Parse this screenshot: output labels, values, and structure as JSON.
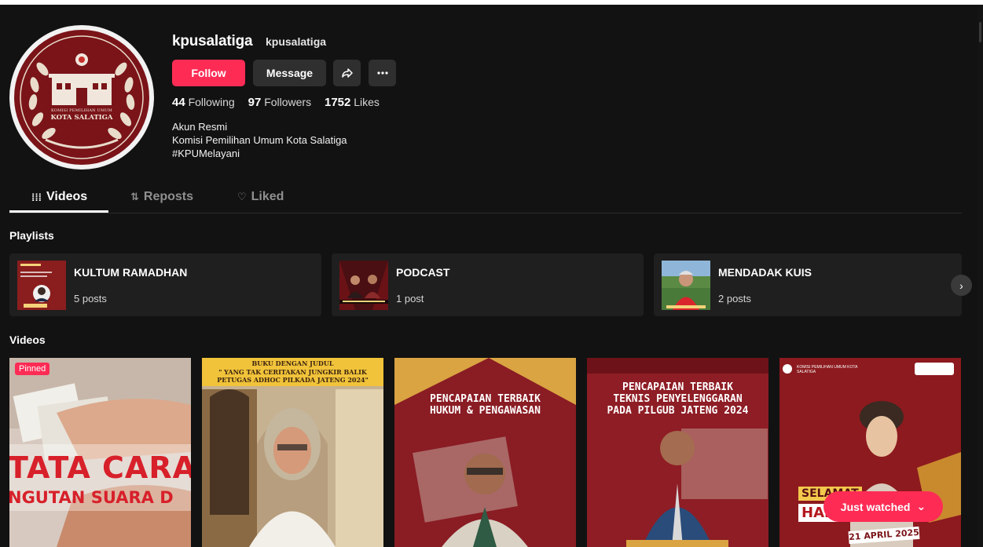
{
  "profile": {
    "username": "kpusalatiga",
    "nickname": "kpusalatiga",
    "avatar_text_line1": "KOMISI PEMILIHAN UMUM",
    "avatar_text_line2": "KOTA SALATIGA",
    "follow_label": "Follow",
    "message_label": "Message",
    "share_icon": "share-icon",
    "more_icon": "more-icon",
    "following_count": "44",
    "following_label": "Following",
    "followers_count": "97",
    "followers_label": "Followers",
    "likes_count": "1752",
    "likes_label": "Likes",
    "bio": [
      "Akun Resmi",
      "Komisi Pemilihan Umum Kota Salatiga",
      "#KPUMelayani"
    ]
  },
  "tabs": [
    {
      "label": "Videos",
      "icon": "grid-icon",
      "active": true
    },
    {
      "label": "Reposts",
      "icon": "repost-icon",
      "active": false
    },
    {
      "label": "Liked",
      "icon": "liked-icon",
      "active": false
    }
  ],
  "playlists": {
    "title": "Playlists",
    "items": [
      {
        "name": "KULTUM RAMADHAN",
        "count": "5 posts"
      },
      {
        "name": "PODCAST",
        "count": "1 post"
      },
      {
        "name": "MENDADAK KUIS",
        "count": "2 posts"
      }
    ]
  },
  "videos": {
    "title": "Videos",
    "pinned_label": "Pinned",
    "items": [
      {
        "line1": "TATA CARA",
        "line2": "NGUTAN SUARA D"
      },
      {
        "line1": "BUKU DENGAN JUDUL",
        "line2": "\" YANG TAK CERITAKAN JUNGKIR BALIK",
        "line3": "PETUGAS ADHOC PILKADA JATENG 2024\""
      },
      {
        "line1": "PENCAPAIAN TERBAIK",
        "line2": "HUKUM & PENGAWASAN"
      },
      {
        "line1": "PENCAPAIAN TERBAIK",
        "line2": "TEKNIS PENYELENGGARAN",
        "line3": "PADA PILGUB JATENG 2024"
      },
      {
        "header": "KOMISI PEMILIHAN UMUM KOTA SALATIGA",
        "line1": "SELAMAT",
        "line2": "HARI KARTINI",
        "date": "21 APRIL 2025"
      }
    ]
  },
  "just_watched_label": "Just watched",
  "colors": {
    "accent": "#fe2c55",
    "background": "#121212",
    "card": "#1f1f1f",
    "maroon": "#7a1419"
  }
}
